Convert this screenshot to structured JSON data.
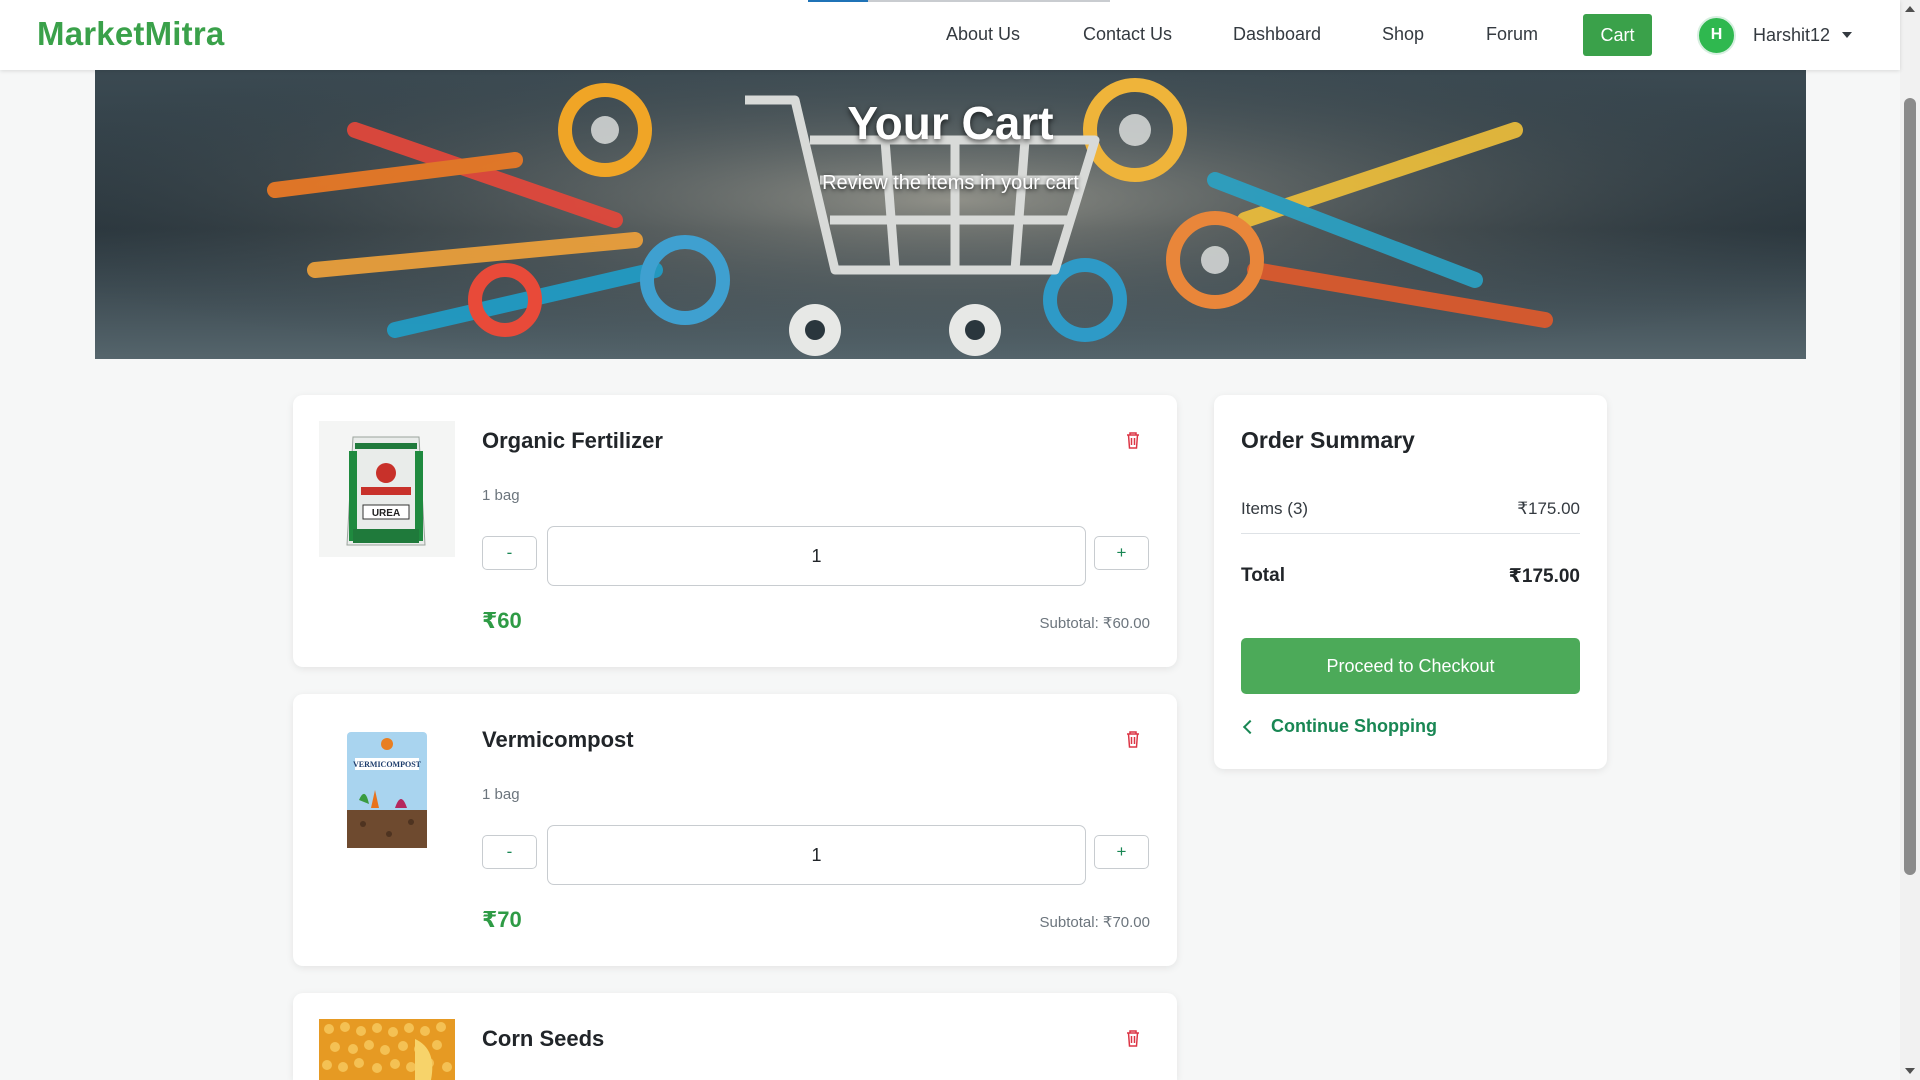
{
  "brand": "MarketMitra",
  "nav": {
    "links": [
      "About Us",
      "Contact Us",
      "Dashboard",
      "Shop",
      "Forum"
    ],
    "cart_label": "Cart",
    "user": {
      "initial": "H",
      "name": "Harshit12"
    }
  },
  "hero": {
    "title": "Your Cart",
    "subtitle": "Review the items in your cart"
  },
  "cart": {
    "items": [
      {
        "name": "Organic Fertilizer",
        "unit": "1 bag",
        "quantity": "1",
        "price": "₹60",
        "subtotal": "Subtotal: ₹60.00",
        "image_icon": "urea-bag-icon"
      },
      {
        "name": "Vermicompost",
        "unit": "1 bag",
        "quantity": "1",
        "price": "₹70",
        "subtotal": "Subtotal: ₹70.00",
        "image_icon": "vermicompost-bag-icon"
      },
      {
        "name": "Corn Seeds",
        "image_icon": "corn-seeds-icon"
      }
    ],
    "minus_label": "-",
    "plus_label": "+"
  },
  "summary": {
    "title": "Order Summary",
    "items_label": "Items (3)",
    "items_value": "₹175.00",
    "total_label": "Total",
    "total_value": "₹175.00",
    "checkout_label": "Proceed to Checkout",
    "continue_label": "Continue Shopping"
  },
  "colors": {
    "brand_green": "#3aa14a",
    "price_green": "#2e9b45",
    "link_green": "#198754",
    "delete_red": "#dc3545",
    "background": "#f6f7f7"
  }
}
